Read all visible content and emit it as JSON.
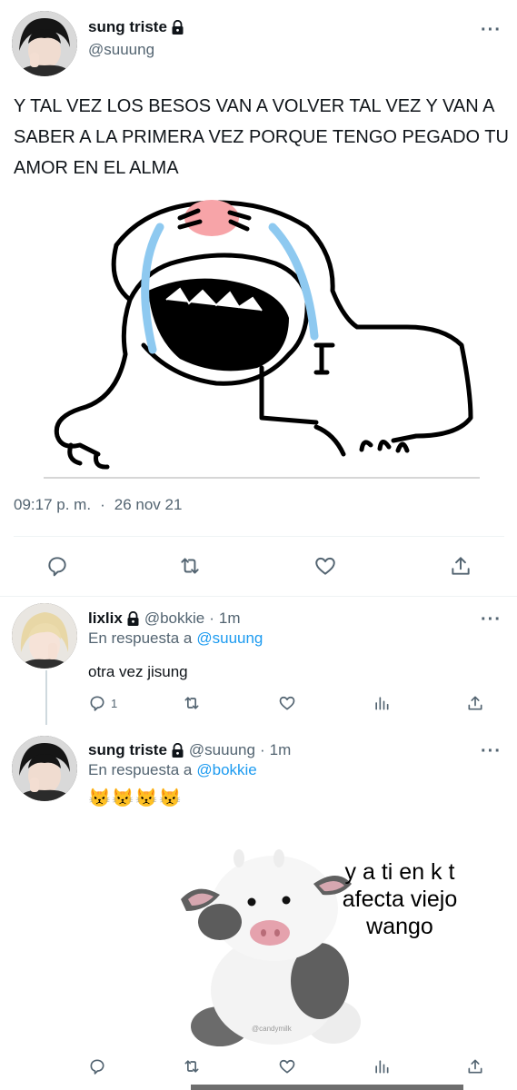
{
  "main_tweet": {
    "display_name": "sung triste",
    "handle": "@suuung",
    "text": "Y TAL VEZ LOS BESOS VAN A VOLVER TAL VEZ Y VAN A SABER A LA PRIMERA VEZ PORQUE TENGO PEGADO TU AMOR EN EL ALMA",
    "time": "09:17 p. m.",
    "separator": "·",
    "date": "26 nov 21",
    "more": "···"
  },
  "reply1": {
    "display_name": "lixlix",
    "handle": "@bokkie",
    "sep": "·",
    "time": "1m",
    "reply_prefix": "En respuesta a",
    "reply_to": "@suuung",
    "text": "otra vez jisung",
    "reply_count": "1",
    "more": "···"
  },
  "reply2": {
    "display_name": "sung triste",
    "handle": "@suuung",
    "sep": "·",
    "time": "1m",
    "reply_prefix": "En respuesta a",
    "reply_to": "@bokkie",
    "text": "😾😾😾😾",
    "meme_text": "y a ti en k t afecta viejo wango",
    "watermark": "@candymilk",
    "more": "···"
  },
  "colors": {
    "accent": "#1d9bf0",
    "muted": "#536471",
    "divider": "#eff3f4"
  }
}
